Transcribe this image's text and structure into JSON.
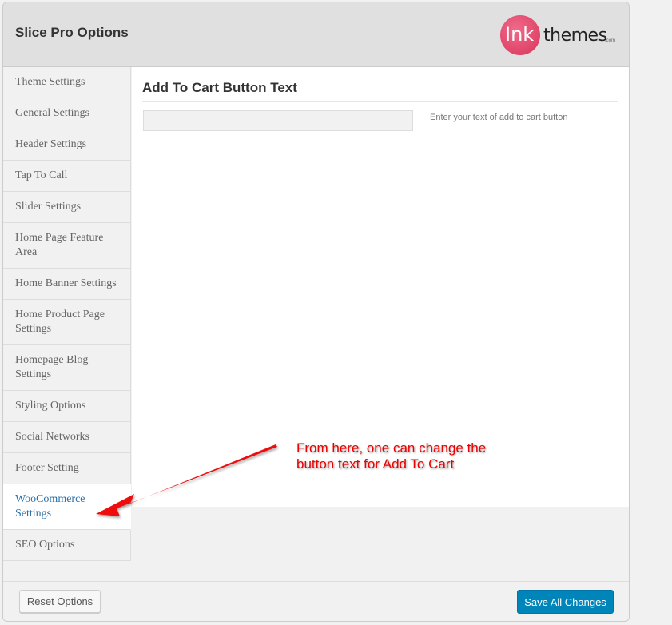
{
  "header": {
    "title": "Slice Pro Options",
    "logo_text": "inkthemes.com"
  },
  "sidebar": {
    "items": [
      {
        "label": "Theme Settings"
      },
      {
        "label": "General Settings"
      },
      {
        "label": "Header Settings"
      },
      {
        "label": "Tap To Call"
      },
      {
        "label": "Slider Settings"
      },
      {
        "label": "Home Page Feature Area"
      },
      {
        "label": "Home Banner Settings"
      },
      {
        "label": "Home Product Page Settings"
      },
      {
        "label": "Homepage Blog Settings"
      },
      {
        "label": "Styling Options"
      },
      {
        "label": "Social Networks"
      },
      {
        "label": "Footer Setting"
      },
      {
        "label": "WooCommerce Settings",
        "active": true
      },
      {
        "label": "SEO Options"
      }
    ]
  },
  "main": {
    "section_title": "Add To Cart Button Text",
    "input_value": "",
    "hint": "Enter your text of add to cart button"
  },
  "footer": {
    "reset_label": "Reset Options",
    "save_label": "Save All Changes"
  },
  "annotation": {
    "text": "From here, one can change the button text for Add To Cart",
    "color": "#ee0000"
  },
  "colors": {
    "accent": "#0085ba",
    "active_link": "#2a6fa8",
    "logo": "#d8345a"
  }
}
